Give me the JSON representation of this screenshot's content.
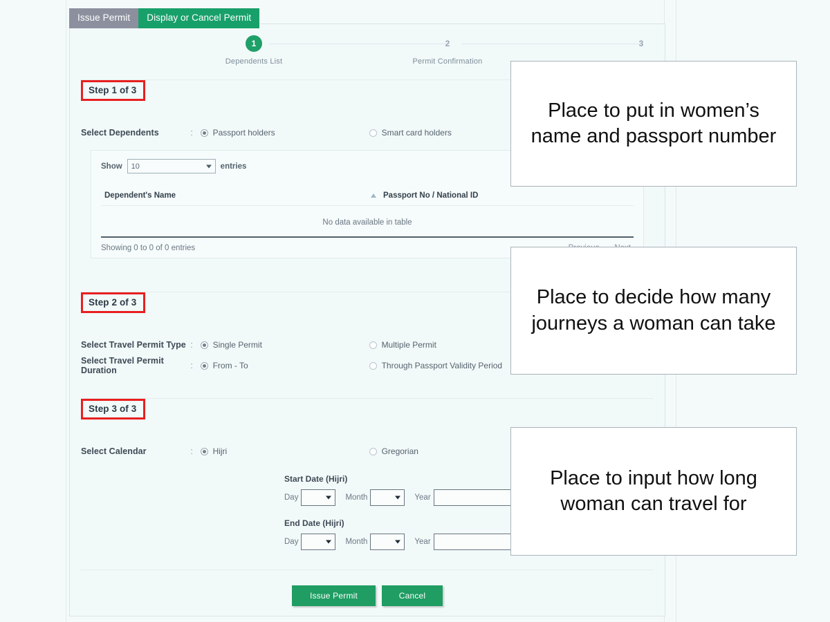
{
  "tabs": [
    {
      "label": "Issue Permit",
      "active": false
    },
    {
      "label": "Display or Cancel Permit",
      "active": true
    }
  ],
  "stepper": {
    "steps": [
      {
        "number": "1",
        "label": "Dependents List",
        "active": true
      },
      {
        "number": "2",
        "label": "Permit Confirmation",
        "active": false
      },
      {
        "number": "3",
        "label": "",
        "active": false
      }
    ]
  },
  "step1": {
    "heading": "Step 1 of 3",
    "select_dependents": {
      "label": "Select Dependents",
      "colon": ":",
      "options": [
        {
          "label": "Passport holders",
          "selected": true
        },
        {
          "label": "Smart card holders",
          "selected": false
        }
      ]
    },
    "table": {
      "show_label": "Show",
      "show_value": "10",
      "entries_label": "entries",
      "columns": [
        "Dependent's Name",
        "Passport No / National ID"
      ],
      "empty_message": "No data available in table",
      "info": "Showing 0 to 0 of 0 entries",
      "previous_label": "Previous",
      "next_label": "Next"
    }
  },
  "step2": {
    "heading": "Step 2 of 3",
    "permit_type": {
      "label": "Select Travel Permit Type",
      "colon": ":",
      "options": [
        {
          "label": "Single Permit",
          "selected": true
        },
        {
          "label": "Multiple Permit",
          "selected": false
        }
      ]
    },
    "permit_duration": {
      "label": "Select Travel Permit Duration",
      "colon": ":",
      "options": [
        {
          "label": "From - To",
          "selected": true
        },
        {
          "label": "Through Passport Validity Period",
          "selected": false
        }
      ]
    }
  },
  "step3": {
    "heading": "Step 3 of 3",
    "calendar": {
      "label": "Select Calendar",
      "colon": ":",
      "options": [
        {
          "label": "Hijri",
          "selected": true
        },
        {
          "label": "Gregorian",
          "selected": false
        }
      ]
    },
    "start_date": {
      "title": "Start Date (Hijri)",
      "day_label": "Day",
      "day_value": "",
      "month_label": "Month",
      "month_value": "",
      "year_label": "Year",
      "year_value": ""
    },
    "end_date": {
      "title": "End Date (Hijri)",
      "day_label": "Day",
      "day_value": "",
      "month_label": "Month",
      "month_value": "",
      "year_label": "Year",
      "year_value": ""
    }
  },
  "footer": {
    "submit_label": "Issue Permit",
    "cancel_label": "Cancel"
  },
  "annotations": [
    {
      "text": "Place to put in women’s name and passport number"
    },
    {
      "text": "Place to decide how many journeys a woman can take"
    },
    {
      "text": "Place to input how long woman can travel for"
    }
  ],
  "colors": {
    "brand_green": "#18a06a",
    "tab_inactive_gray": "#8c909e",
    "highlight_red": "#e81f1f",
    "page_background": "#f4fafa"
  }
}
